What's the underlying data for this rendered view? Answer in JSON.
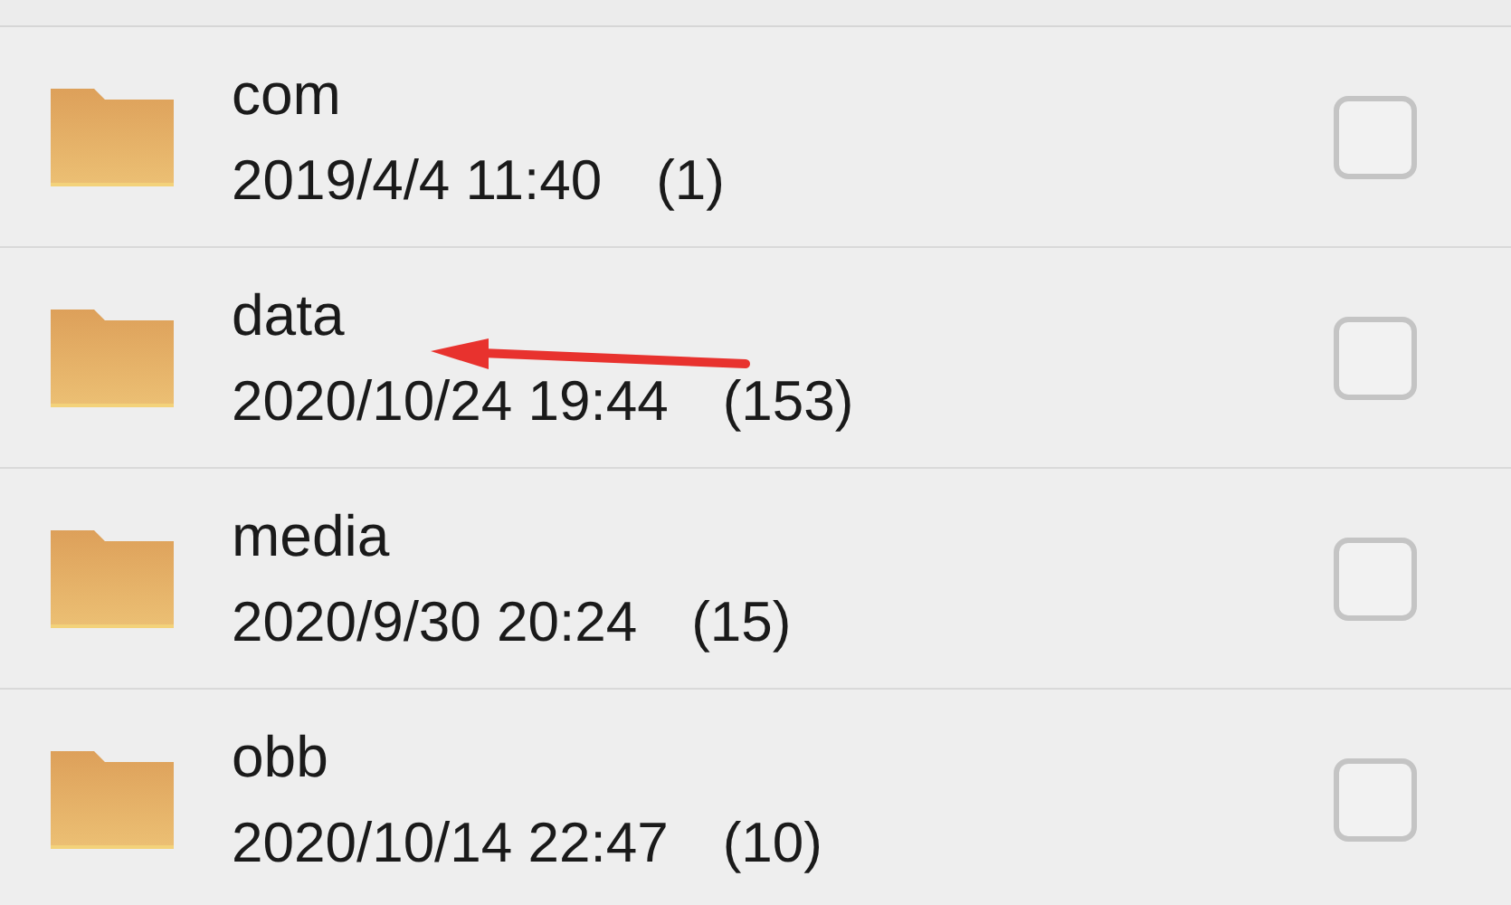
{
  "folders": [
    {
      "name": "com",
      "modified": "2019/4/4 11:40",
      "count": "(1)",
      "checked": false
    },
    {
      "name": "data",
      "modified": "2020/10/24 19:44",
      "count": "(153)",
      "checked": false
    },
    {
      "name": "media",
      "modified": "2020/9/30 20:24",
      "count": "(15)",
      "checked": false
    },
    {
      "name": "obb",
      "modified": "2020/10/14 22:47",
      "count": "(10)",
      "checked": false
    }
  ]
}
